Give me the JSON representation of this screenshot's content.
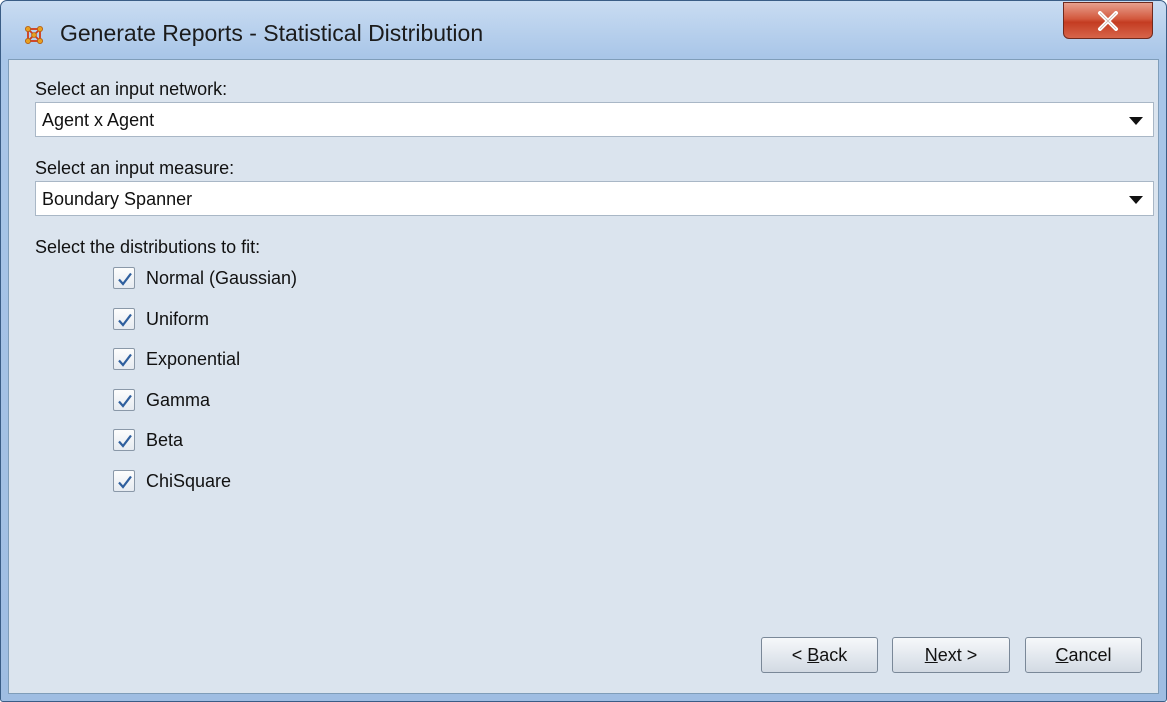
{
  "window": {
    "title": "Generate Reports - Statistical Distribution"
  },
  "network": {
    "label": "Select an input network:",
    "selected": "Agent x Agent"
  },
  "measure": {
    "label": "Select an input measure:",
    "selected": "Boundary Spanner"
  },
  "distributions": {
    "label": "Select the distributions to fit:",
    "items": [
      {
        "label": "Normal (Gaussian)",
        "checked": true
      },
      {
        "label": "Uniform",
        "checked": true
      },
      {
        "label": "Exponential",
        "checked": true
      },
      {
        "label": "Gamma",
        "checked": true
      },
      {
        "label": "Beta",
        "checked": true
      },
      {
        "label": "ChiSquare",
        "checked": true
      }
    ]
  },
  "buttons": {
    "back_mnemonic": "B",
    "back_rest": "ack",
    "back_prefix": "< ",
    "next_mnemonic": "N",
    "next_rest": "ext >",
    "cancel_mnemonic": "C",
    "cancel_rest": "ancel"
  },
  "colors": {
    "accent_check": "#2f5f9e",
    "close_button": "#c43c22"
  }
}
